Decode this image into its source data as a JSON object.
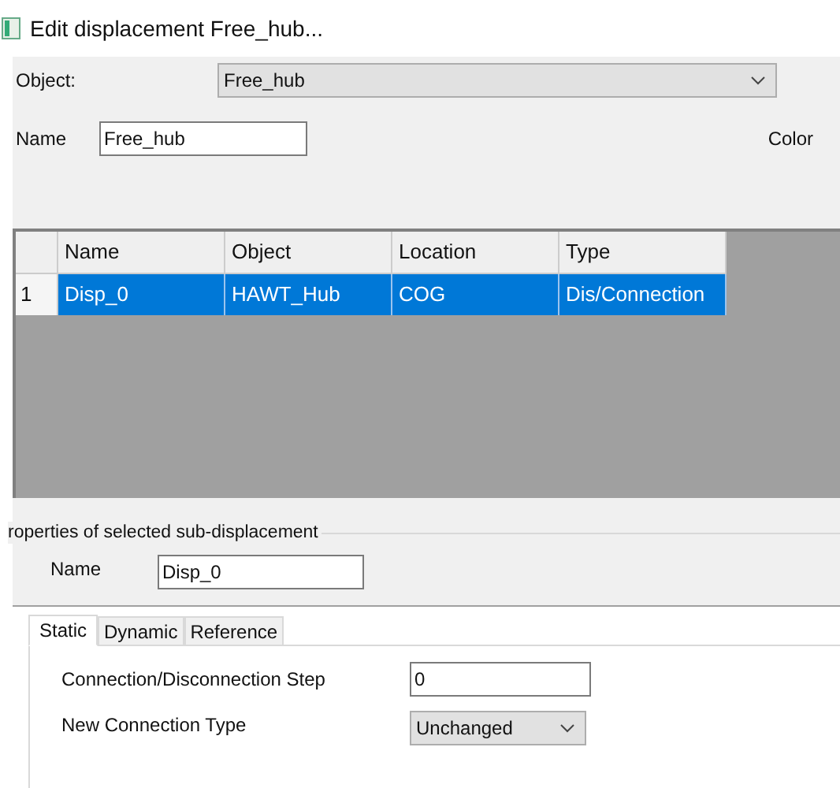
{
  "window": {
    "title": "Edit displacement Free_hub..."
  },
  "object_field": {
    "label": "Object:",
    "value": "Free_hub"
  },
  "name_field": {
    "label": "Name",
    "value": "Free_hub"
  },
  "color_label": "Color",
  "table": {
    "columns": [
      "Name",
      "Object",
      "Location",
      "Type"
    ],
    "rows": [
      {
        "index": "1",
        "cells": [
          "Disp_0",
          "HAWT_Hub",
          "COG",
          "Dis/Connection"
        ],
        "selected": true
      }
    ]
  },
  "properties": {
    "title": "roperties of selected sub-displacement",
    "name_label": "Name",
    "name_value": "Disp_0"
  },
  "tabs": [
    {
      "label": "Static",
      "selected": true
    },
    {
      "label": "Dynamic",
      "selected": false
    },
    {
      "label": "Reference",
      "selected": false
    }
  ],
  "static": {
    "step_label": "Connection/Disconnection Step",
    "step_value": "0",
    "type_label": "New Connection Type",
    "type_value": "Unchanged"
  }
}
